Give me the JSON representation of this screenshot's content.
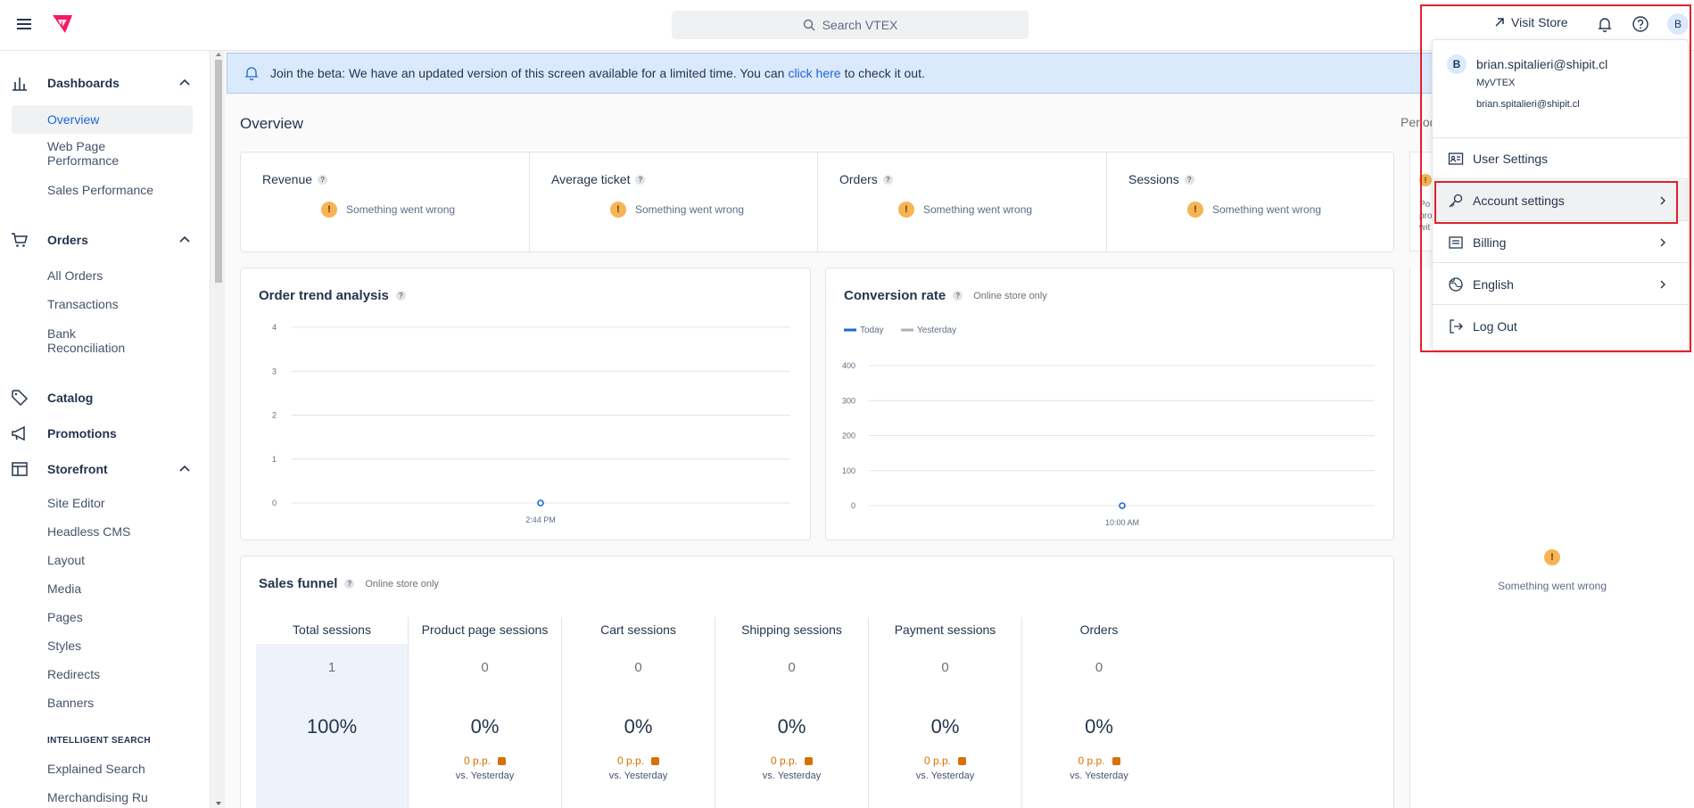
{
  "topbar": {
    "search_placeholder": "Search VTEX",
    "visit_store": "Visit Store",
    "avatar_initial": "B"
  },
  "sidebar": {
    "dashboards": {
      "label": "Dashboards",
      "items": [
        "Overview",
        "Web Page Performance",
        "Sales Performance"
      ]
    },
    "orders": {
      "label": "Orders",
      "items": [
        "All Orders",
        "Transactions",
        "Bank Reconciliation"
      ]
    },
    "catalog": "Catalog",
    "promotions": "Promotions",
    "storefront": {
      "label": "Storefront",
      "items": [
        "Site Editor",
        "Headless CMS",
        "Layout",
        "Media",
        "Pages",
        "Styles",
        "Redirects",
        "Banners"
      ]
    },
    "intelligent_search": {
      "header": "INTELLIGENT SEARCH",
      "items": [
        "Explained Search",
        "Merchandising Ru"
      ]
    }
  },
  "beta": {
    "text_before": "Join the beta: We have an updated version of this screen available for a limited time. You can",
    "link": "click here",
    "text_after": "to check it out."
  },
  "overview": {
    "title": "Overview",
    "period_label": "Period",
    "kpis": [
      {
        "label": "Revenue",
        "status": "Something went wrong"
      },
      {
        "label": "Average ticket",
        "status": "Something went wrong"
      },
      {
        "label": "Orders",
        "status": "Something went wrong"
      },
      {
        "label": "Sessions",
        "status": "Something went wrong"
      }
    ]
  },
  "order_trend": {
    "title": "Order trend analysis",
    "y_ticks": [
      "4",
      "3",
      "2",
      "1",
      "0"
    ],
    "x_label": "2:44 PM"
  },
  "conversion": {
    "title": "Conversion rate",
    "tag": "Online store only",
    "legend": [
      "Today",
      "Yesterday"
    ],
    "y_ticks": [
      "400",
      "300",
      "200",
      "100",
      "0"
    ],
    "x_label": "10:00 AM"
  },
  "chart_data": [
    {
      "type": "line",
      "title": "Order trend analysis",
      "ylim": [
        0,
        4
      ],
      "yticks": [
        0,
        1,
        2,
        3,
        4
      ],
      "x": [
        "2:44 PM"
      ],
      "series": [
        {
          "values": [
            0
          ]
        }
      ]
    },
    {
      "type": "line",
      "title": "Conversion rate",
      "ylim": [
        0,
        400
      ],
      "yticks": [
        0,
        100,
        200,
        300,
        400
      ],
      "x": [
        "10:00 AM"
      ],
      "series": [
        {
          "name": "Today",
          "values": [
            0
          ]
        },
        {
          "name": "Yesterday",
          "values": []
        }
      ],
      "legend": "top-left"
    }
  ],
  "funnel": {
    "title": "Sales funnel",
    "tag": "Online store only",
    "vs_label": "vs. Yesterday",
    "columns": [
      {
        "label": "Total sessions",
        "count": "1",
        "pct": "100%"
      },
      {
        "label": "Product page sessions",
        "count": "0",
        "pct": "0%",
        "pp": "0 p.p."
      },
      {
        "label": "Cart sessions",
        "count": "0",
        "pct": "0%",
        "pp": "0 p.p."
      },
      {
        "label": "Shipping sessions",
        "count": "0",
        "pct": "0%",
        "pp": "0 p.p."
      },
      {
        "label": "Payment sessions",
        "count": "0",
        "pct": "0%",
        "pp": "0 p.p."
      },
      {
        "label": "Orders",
        "count": "0",
        "pct": "0%",
        "pp": "0 p.p."
      }
    ]
  },
  "right_panel": {
    "status": "Something went wrong",
    "partial_text": [
      "Po",
      "pro",
      "wit"
    ]
  },
  "dropdown": {
    "avatar_initial": "B",
    "email": "brian.spitalieri@shipit.cl",
    "account": "MyVTEX",
    "email_small": "brian.spitalieri@shipit.cl",
    "items": [
      {
        "label": "User Settings"
      },
      {
        "label": "Account settings"
      },
      {
        "label": "Billing"
      },
      {
        "label": "English"
      },
      {
        "label": "Log Out"
      }
    ]
  },
  "colors": {
    "accent": "#1f67d1",
    "warning": "#f6b454",
    "pp_orange": "#d57200",
    "highlight_red": "#e0202b",
    "brand": "#f71963"
  }
}
